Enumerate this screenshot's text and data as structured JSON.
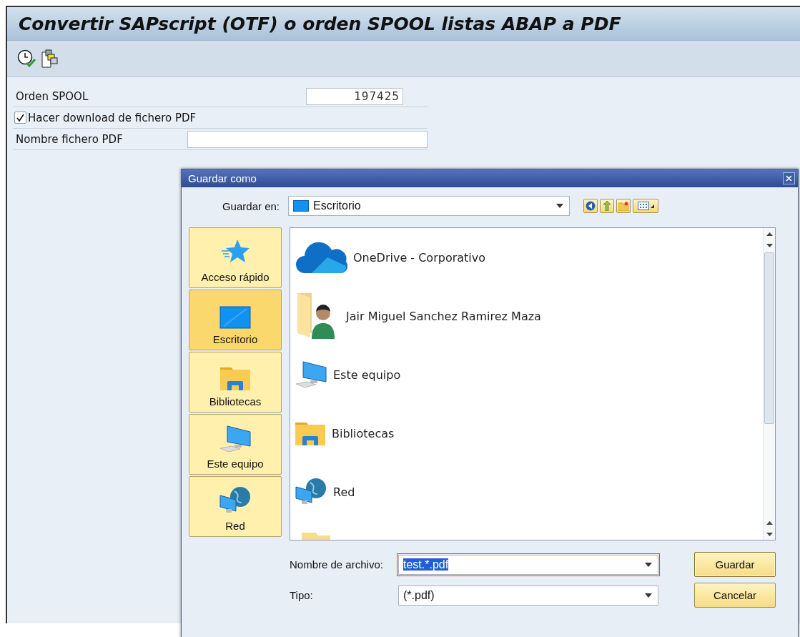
{
  "window": {
    "title": "Convertir SAPscript (OTF) o orden SPOOL listas ABAP a PDF"
  },
  "toolbar": [
    {
      "kind": "execute"
    },
    {
      "kind": "copy"
    }
  ],
  "form": [
    {
      "kind": "number",
      "label": "Orden SPOOL",
      "value": "197425"
    },
    {
      "kind": "checkbox",
      "label": "Hacer download de fichero PDF",
      "checked": true
    },
    {
      "kind": "text",
      "label": "Nombre fichero PDF"
    }
  ],
  "dialog": {
    "title": "Guardar como",
    "location": {
      "label": "Guardar en:",
      "value": "Escritorio"
    },
    "nav_buttons": [
      {
        "kind": "back"
      },
      {
        "kind": "up"
      },
      {
        "kind": "new-folder"
      },
      {
        "kind": "view"
      }
    ],
    "places": [
      {
        "label": "Acceso rápido",
        "kind": "star",
        "selected": false
      },
      {
        "label": "Escritorio",
        "kind": "desktop",
        "selected": true
      },
      {
        "label": "Bibliotecas",
        "kind": "library",
        "selected": false
      },
      {
        "label": "Este equipo",
        "kind": "computer",
        "selected": false
      },
      {
        "label": "Red",
        "kind": "network",
        "selected": false
      }
    ],
    "files": [
      {
        "label": "OneDrive - Corporativo",
        "kind": "cloud"
      },
      {
        "label": "Jair Miguel Sanchez Ramirez Maza",
        "kind": "user-folder"
      },
      {
        "label": "Este equipo",
        "kind": "computer"
      },
      {
        "label": "Bibliotecas",
        "kind": "library"
      },
      {
        "label": "Red",
        "kind": "network"
      },
      {
        "kind": "folder"
      }
    ],
    "filename": {
      "label": "Nombre de archivo:",
      "value": "test.*.pdf",
      "highlighted": true
    },
    "type": {
      "label": "Tipo:",
      "value": "(*.pdf)"
    },
    "buttons": [
      {
        "label": "Guardar",
        "kind": "default"
      },
      {
        "label": "Cancelar",
        "kind": "normal"
      }
    ]
  }
}
